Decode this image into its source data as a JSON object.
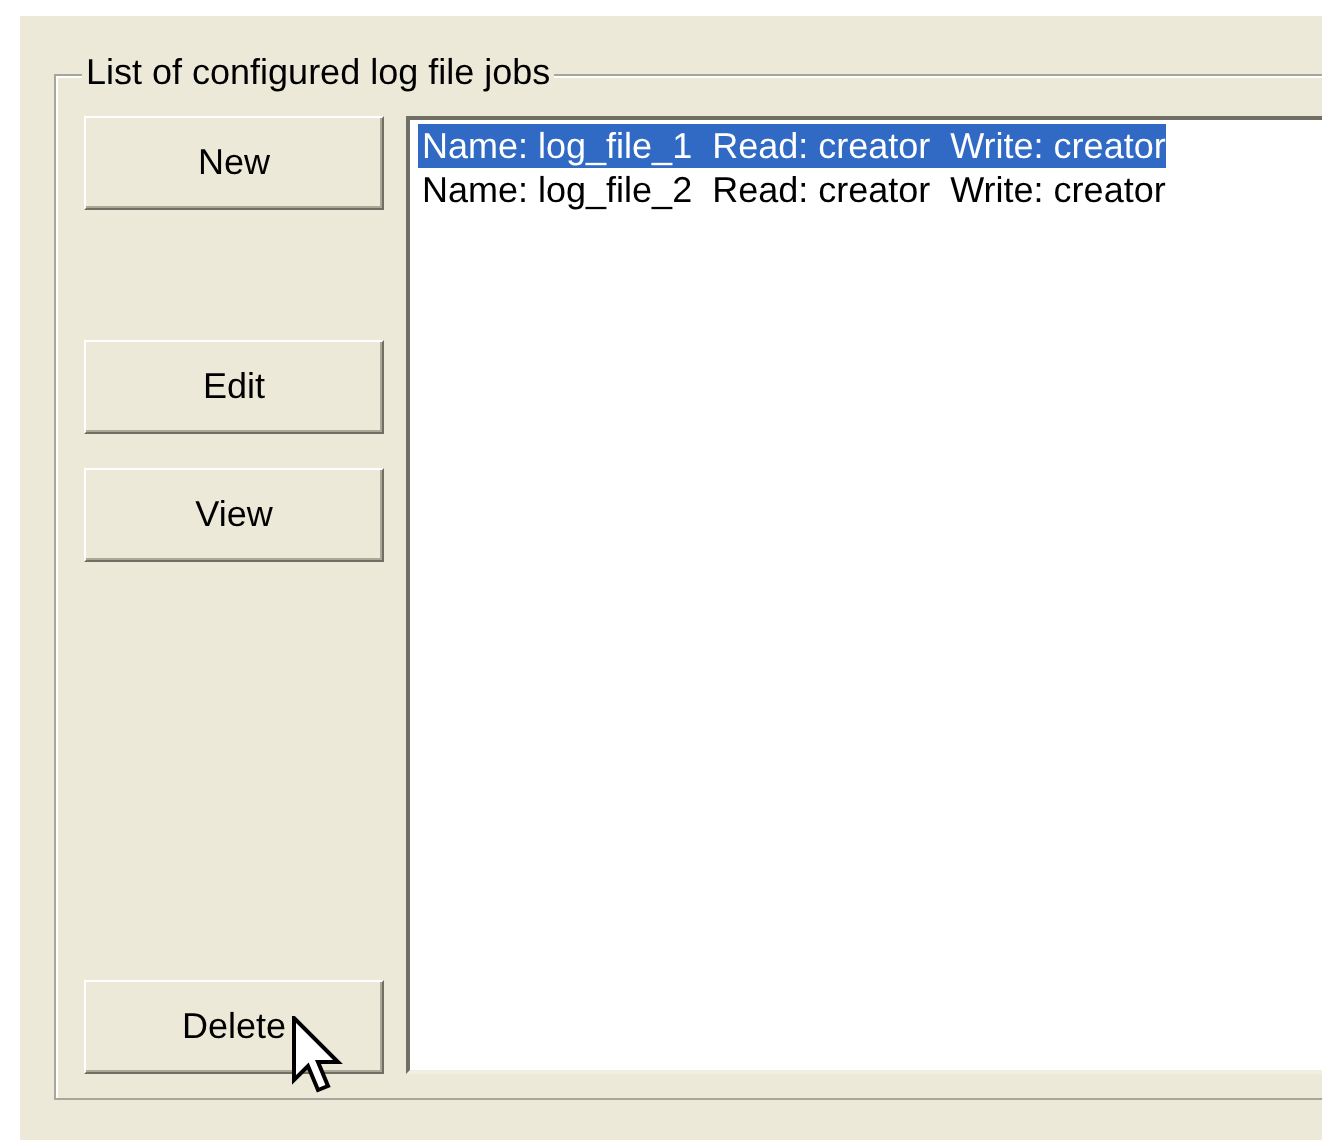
{
  "group": {
    "title": "List of configured log file jobs"
  },
  "buttons": [
    {
      "label": "New",
      "kind": "top"
    },
    {
      "label": "Edit",
      "kind": "middle"
    },
    {
      "label": "View",
      "kind": "middle"
    },
    {
      "label": "Delete",
      "kind": "bottom"
    }
  ],
  "jobs": [
    {
      "text": "Name: log_file_1  Read: creator  Write: creator",
      "selected": true
    },
    {
      "text": "Name: log_file_2  Read: creator  Write: creator",
      "selected": false
    }
  ]
}
